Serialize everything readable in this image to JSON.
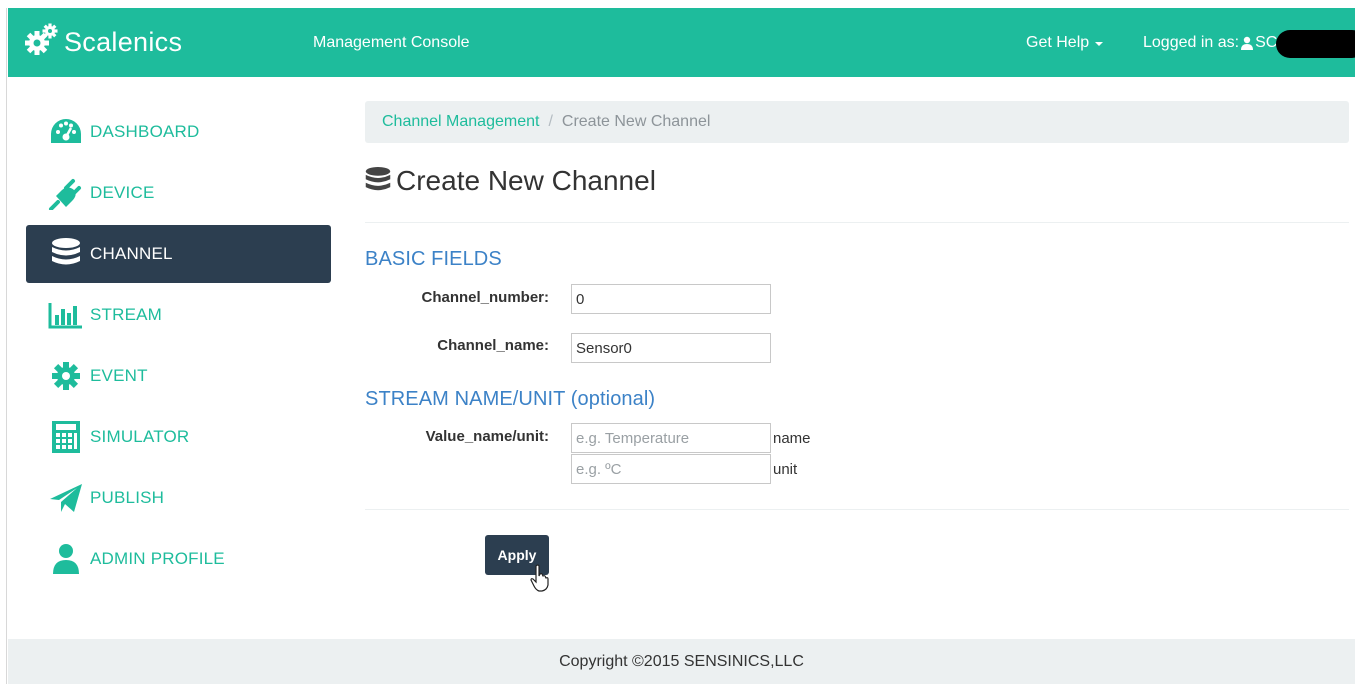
{
  "navbar": {
    "brand": "Scalenics",
    "console_label": "Management Console",
    "help_label": "Get Help",
    "logged_in_label": "Logged in as:",
    "username_visible": "SC"
  },
  "sidebar": {
    "items": [
      {
        "label": "DASHBOARD",
        "icon": "dashboard-icon"
      },
      {
        "label": "DEVICE",
        "icon": "plug-icon"
      },
      {
        "label": "CHANNEL",
        "icon": "database-icon",
        "active": true
      },
      {
        "label": "STREAM",
        "icon": "bar-chart-icon"
      },
      {
        "label": "EVENT",
        "icon": "gear-icon"
      },
      {
        "label": "SIMULATOR",
        "icon": "calculator-icon"
      },
      {
        "label": "PUBLISH",
        "icon": "paper-plane-icon"
      },
      {
        "label": "ADMIN PROFILE",
        "icon": "user-icon"
      }
    ]
  },
  "breadcrumb": {
    "link": "Channel Management",
    "separator": "/",
    "current": "Create New Channel"
  },
  "page": {
    "title": "Create New Channel"
  },
  "form": {
    "basic_heading": "BASIC FIELDS",
    "channel_number_label": "Channel_number:",
    "channel_number_value": "0",
    "channel_name_label": "Channel_name:",
    "channel_name_value": "Sensor0",
    "stream_heading": "STREAM NAME/UNIT (optional)",
    "value_label": "Value_name/unit:",
    "value_name_placeholder": "e.g. Temperature",
    "value_name_suffix": "name",
    "value_unit_placeholder": "e.g. ºC",
    "value_unit_suffix": "unit",
    "apply_label": "Apply"
  },
  "footer": {
    "copyright": "Copyright ©2015 SENSINICS,LLC"
  },
  "colors": {
    "accent": "#1ebc9c",
    "dark": "#2c3e50",
    "heading_blue": "#3c82c7",
    "light_bg": "#ecf0f1"
  }
}
